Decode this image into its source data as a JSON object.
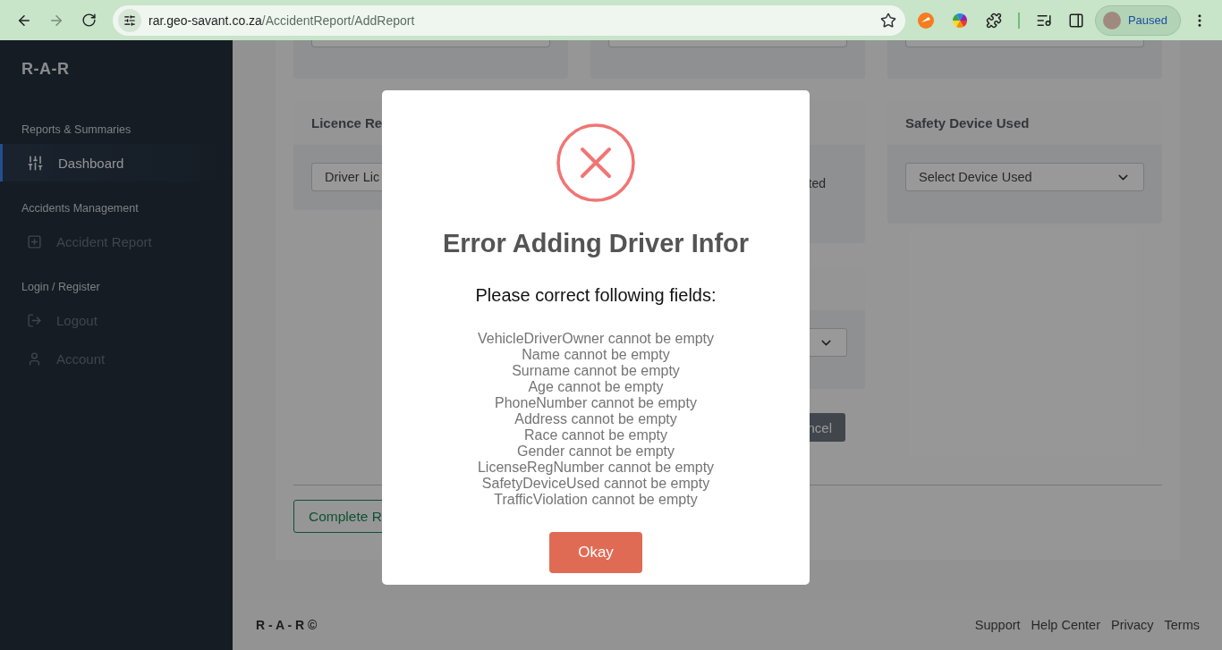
{
  "browser": {
    "url_host": "rar.geo-savant.co.za",
    "url_path": "/AccidentReport/AddReport",
    "profile": "Paused"
  },
  "sidebar": {
    "brand": "R-A-R",
    "sections": [
      {
        "heading": "Reports & Summaries",
        "items": [
          {
            "label": "Dashboard",
            "kind": "sliders",
            "selected": true
          }
        ]
      },
      {
        "heading": "Accidents Management",
        "items": [
          {
            "label": "Accident Report",
            "kind": "add",
            "selected": false
          }
        ]
      },
      {
        "heading": "Login / Register",
        "items": [
          {
            "label": "Logout",
            "kind": "logout",
            "selected": false
          },
          {
            "label": "Account",
            "kind": "account",
            "selected": false
          }
        ]
      }
    ]
  },
  "form": {
    "cards": [
      {
        "kind": "input",
        "title": "Licence Re",
        "value": "Driver Lic"
      },
      {
        "kind": "text",
        "text": "ted"
      },
      {
        "kind": "select",
        "title": "Safety Device Used",
        "value": "Select Device Used"
      }
    ],
    "cancel_button": "ncel",
    "complete_button": "Complete R"
  },
  "footer": {
    "brand": "R - A - R ©",
    "links": [
      "Support",
      "Help Center",
      "Privacy",
      "Terms"
    ]
  },
  "dialog": {
    "title": "Error Adding Driver Infor",
    "subtitle": "Please correct following fields:",
    "messages": [
      "VehicleDriverOwner cannot be empty",
      "Name cannot be empty",
      "Surname cannot be empty",
      "Age cannot be empty",
      "PhoneNumber cannot be empty",
      "Address cannot be empty",
      "Race cannot be empty",
      "Gender cannot be empty",
      "LicenseRegNumber cannot be empty",
      "SafetyDeviceUsed cannot be empty",
      "TrafficViolation cannot be empty"
    ],
    "button": "Okay"
  }
}
